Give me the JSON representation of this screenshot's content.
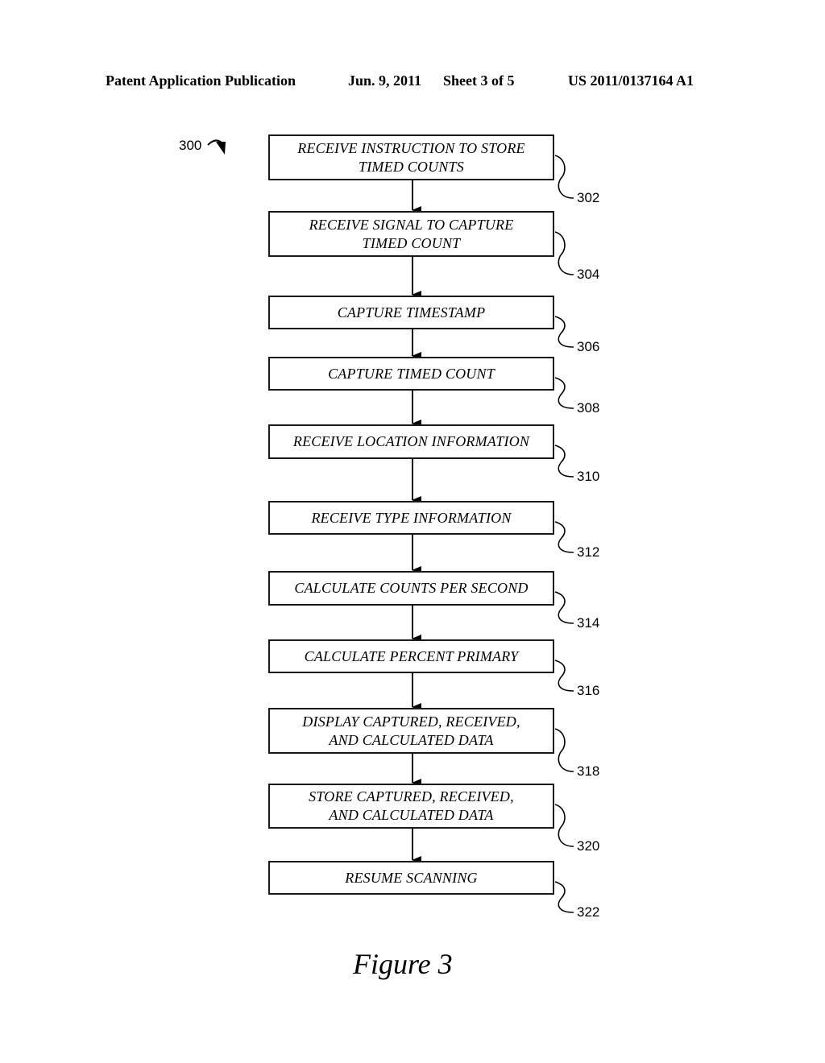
{
  "header": {
    "publication": "Patent Application Publication",
    "date": "Jun. 9, 2011",
    "sheet": "Sheet 3 of 5",
    "number": "US 2011/0137164 A1"
  },
  "figure": {
    "ref": "300",
    "label": "Figure 3"
  },
  "steps": [
    {
      "ref": "302",
      "lines": [
        "RECEIVE INSTRUCTION TO STORE",
        "TIMED COUNTS"
      ]
    },
    {
      "ref": "304",
      "lines": [
        "RECEIVE SIGNAL TO CAPTURE",
        "TIMED COUNT"
      ]
    },
    {
      "ref": "306",
      "lines": [
        "CAPTURE TIMESTAMP"
      ]
    },
    {
      "ref": "308",
      "lines": [
        "CAPTURE TIMED COUNT"
      ]
    },
    {
      "ref": "310",
      "lines": [
        "RECEIVE LOCATION INFORMATION"
      ]
    },
    {
      "ref": "312",
      "lines": [
        "RECEIVE TYPE INFORMATION"
      ]
    },
    {
      "ref": "314",
      "lines": [
        "CALCULATE COUNTS PER SECOND"
      ]
    },
    {
      "ref": "316",
      "lines": [
        "CALCULATE PERCENT PRIMARY"
      ]
    },
    {
      "ref": "318",
      "lines": [
        "DISPLAY CAPTURED, RECEIVED,",
        "AND CALCULATED DATA"
      ]
    },
    {
      "ref": "320",
      "lines": [
        "STORE CAPTURED, RECEIVED,",
        "AND CALCULATED DATA"
      ]
    },
    {
      "ref": "322",
      "lines": [
        "RESUME SCANNING"
      ]
    }
  ]
}
